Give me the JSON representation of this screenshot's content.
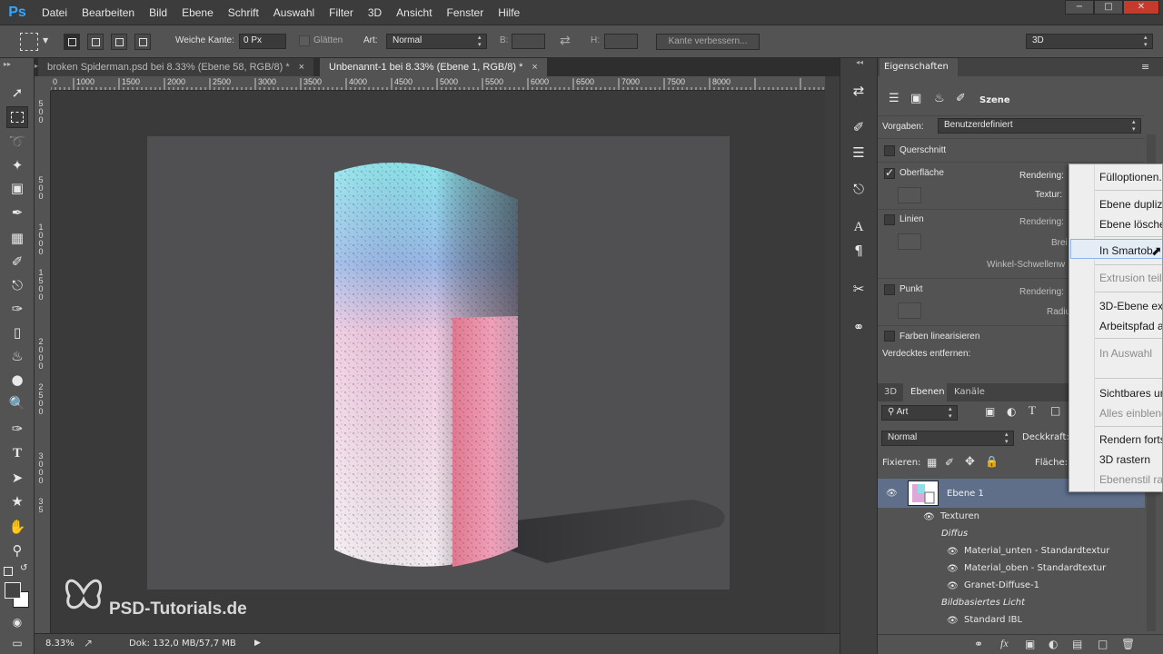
{
  "app": {
    "logo": "Ps"
  },
  "menu": [
    "Datei",
    "Bearbeiten",
    "Bild",
    "Ebene",
    "Schrift",
    "Auswahl",
    "Filter",
    "3D",
    "Ansicht",
    "Fenster",
    "Hilfe"
  ],
  "window_controls": {
    "minimize": "−",
    "restore": "□",
    "close": "✕"
  },
  "options": {
    "weiche_kante_label": "Weiche Kante:",
    "weiche_kante_value": "0 Px",
    "glaetten_label": "Glätten",
    "art_label": "Art:",
    "art_value": "Normal",
    "b_label": "B:",
    "h_label": "H:",
    "kante_button": "Kante verbessern...",
    "workspace": "3D"
  },
  "tabs": [
    {
      "label": "broken Spiderman.psd bei 8.33% (Ebene 58, RGB/8) *",
      "close": "×"
    },
    {
      "label": "Unbenannt-1 bei 8.33% (Ebene 1, RGB/8) *",
      "close": "×"
    }
  ],
  "ruler": {
    "top": [
      "0",
      "1000",
      "1500",
      "2000",
      "2500",
      "3000",
      "3500",
      "4000",
      "4500",
      "5000",
      "5500",
      "6000",
      "6500",
      "7000",
      "7500",
      "8000"
    ],
    "top_lead": "0",
    "left": [
      "5",
      "0",
      "0",
      "5",
      "0",
      "0",
      "1",
      "0",
      "0",
      "0",
      "1",
      "5",
      "0",
      "0",
      "2",
      "0",
      "0",
      "0",
      "2",
      "5",
      "0",
      "0",
      "3",
      "0",
      "0",
      "0",
      "3",
      "5"
    ]
  },
  "status": {
    "zoom": "8.33%",
    "doc": "Dok: 132,0 MB/57,7 MB"
  },
  "properties": {
    "tab": "Eigenschaften",
    "scene_label": "Szene",
    "vorgaben_label": "Vorgaben:",
    "vorgaben_value": "Benutzerdefiniert",
    "querschnitt": "Querschnitt",
    "oberflaeche": "Oberfläche",
    "rendering": "Rendering:",
    "textur": "Textur:",
    "linien": "Linien",
    "breite": "Brei",
    "winkel": "Winkel-Schwellenw",
    "punkt": "Punkt",
    "radius": "Radiu",
    "farben": "Farben linearisieren",
    "verdecktes": "Verdecktes entfernen:"
  },
  "layers": {
    "tabs": [
      "3D",
      "Ebenen",
      "Kanäle"
    ],
    "filter_kind": "Art",
    "blend_mode": "Normal",
    "opacity_label": "Deckkraft:",
    "lock_label": "Fixieren:",
    "fill_label": "Fläche:",
    "layer_name": "Ebene 1",
    "textures": "Texturen",
    "diffus": "Diffus",
    "items": [
      "Material_unten - Standardtextur",
      "Material_oben - Standardtextur",
      "Granet-Diffuse-1"
    ],
    "ibl": "Bildbasiertes Licht",
    "ibl_item": "Standard IBL"
  },
  "context_menu": [
    {
      "label": "Fülloptionen.",
      "disabled": false
    },
    {
      "label": "Ebene dupliz",
      "disabled": false
    },
    {
      "label": "Ebene lösche",
      "disabled": false
    },
    {
      "label": "In Smartob",
      "disabled": false
    },
    {
      "label": "Extrusion teile",
      "disabled": true
    },
    {
      "label": "3D-Ebene exp",
      "disabled": false
    },
    {
      "label": "Arbeitspfad a",
      "disabled": false
    },
    {
      "label": "In Auswahl",
      "disabled": true
    },
    {
      "label": "Sichtbares un",
      "disabled": false
    },
    {
      "label": "Alles einblend",
      "disabled": true
    },
    {
      "label": "Rendern forts",
      "disabled": false
    },
    {
      "label": "3D rastern",
      "disabled": false
    },
    {
      "label": "Ebenenstil ras",
      "disabled": true
    }
  ],
  "watermark": "PSD-Tutorials.de"
}
